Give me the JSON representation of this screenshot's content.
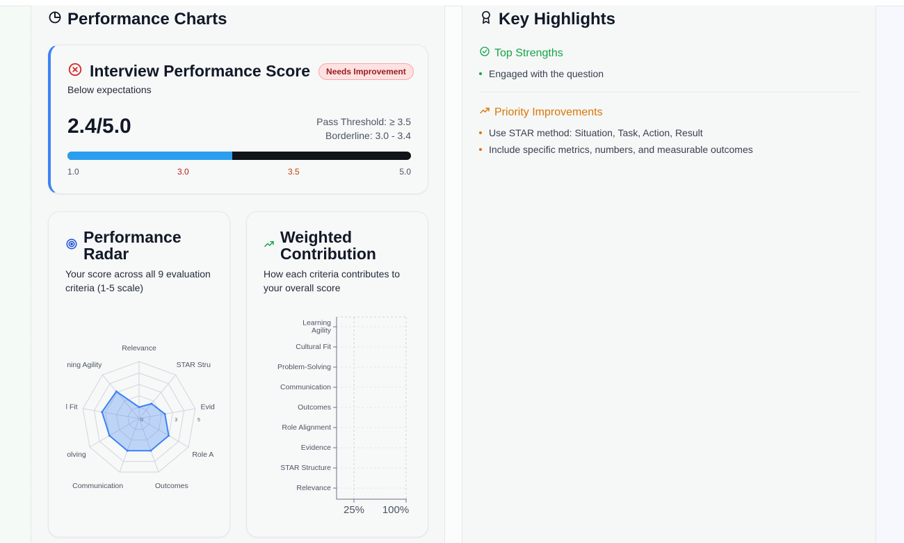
{
  "performance_charts": {
    "title": "Performance Charts",
    "score_card": {
      "title": "Interview Performance Score",
      "badge": "Needs Improvement",
      "subtitle": "Below expectations",
      "score": "2.4/5.0",
      "pass_threshold": "Pass Threshold: ≥ 3.5",
      "borderline": "Borderline: 3.0 - 3.4",
      "progress_fraction": 0.48,
      "ticks": [
        "1.0",
        "3.0",
        "3.5",
        "5.0"
      ],
      "colors": {
        "accent": "#3b82f6",
        "fill": "#2b9ef0",
        "track": "#111418",
        "fail": "#b91c1c",
        "borderline": "#c2410c"
      }
    },
    "radar": {
      "title_line1": "Performance",
      "title_line2": "Radar",
      "subtitle": "Your score across all 9 evaluation criteria (1-5 scale)",
      "icon": "target-icon"
    },
    "weighted": {
      "title_line1": "Weighted",
      "title_line2": "Contribution",
      "subtitle": "How each criteria contributes to your overall score",
      "icon": "trending-up-icon"
    }
  },
  "chart_data": [
    {
      "type": "radar",
      "categories": [
        "Relevance",
        "STAR Structure",
        "Evidence",
        "Role Alignment",
        "Outcomes",
        "Communication",
        "Problem-Solving",
        "Cultural Fit",
        "Learning Agility"
      ],
      "visible_category_labels": [
        "Relevance",
        "STAR Stru",
        "Evid",
        "Role A",
        "Outcomes",
        "Communication",
        "olving",
        "l Fit",
        "ning Agility"
      ],
      "values": [
        1,
        1.7,
        2.3,
        3.0,
        3.0,
        3.0,
        3.0,
        3.3,
        3.1
      ],
      "rlim": [
        0,
        5
      ],
      "radial_tick_labels": [
        "0",
        "3",
        "5"
      ],
      "grid": true
    },
    {
      "type": "bar",
      "orientation": "horizontal",
      "categories": [
        "Learning Agility",
        "Cultural Fit",
        "Problem-Solving",
        "Communication",
        "Outcomes",
        "Role Alignment",
        "Evidence",
        "STAR Structure",
        "Relevance"
      ],
      "category_label_lines": [
        [
          "Learning",
          "Agility"
        ],
        [
          "Cultural Fit"
        ],
        [
          "Problem-Solving"
        ],
        [
          "Communication"
        ],
        [
          "Outcomes"
        ],
        [
          "Role Alignment"
        ],
        [
          "Evidence"
        ],
        [
          "STAR Structure"
        ],
        [
          "Relevance"
        ]
      ],
      "values": [
        0,
        0,
        0,
        0,
        0,
        0,
        0,
        0,
        0
      ],
      "x_tick_labels": [
        "25%",
        "100%"
      ],
      "grid": true
    }
  ],
  "key_highlights": {
    "title": "Key Highlights",
    "strengths_label": "Top Strengths",
    "strengths": [
      "Engaged with the question"
    ],
    "improvements_label": "Priority Improvements",
    "improvements": [
      "Use STAR method: Situation, Task, Action, Result",
      "Include specific metrics, numbers, and measurable outcomes"
    ],
    "colors": {
      "strength": "#16a34a",
      "improvement": "#d97706"
    }
  }
}
